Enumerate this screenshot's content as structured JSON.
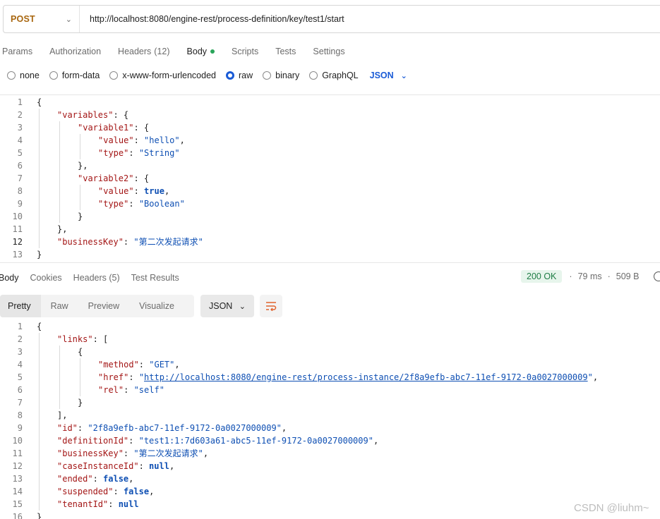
{
  "request": {
    "method": "POST",
    "url": "http://localhost:8080/engine-rest/process-definition/key/test1/start"
  },
  "request_tabs": {
    "params": "Params",
    "authorization": "Authorization",
    "headers": "Headers",
    "headers_count": "(12)",
    "body": "Body",
    "scripts": "Scripts",
    "tests": "Tests",
    "settings": "Settings"
  },
  "body_types": {
    "none": "none",
    "form_data": "form-data",
    "urlencoded": "x-www-form-urlencoded",
    "raw": "raw",
    "binary": "binary",
    "graphql": "GraphQL",
    "selected": "raw",
    "format": "JSON"
  },
  "request_body": {
    "lines": [
      {
        "n": "1",
        "t": "{"
      },
      {
        "n": "2",
        "k": "\"variables\"",
        "t2": ": {"
      },
      {
        "n": "3",
        "k": "\"variable1\"",
        "t2": ": {"
      },
      {
        "n": "4",
        "k": "\"value\"",
        "t2": ": ",
        "s": "\"hello\"",
        "t3": ","
      },
      {
        "n": "5",
        "k": "\"type\"",
        "t2": ": ",
        "s": "\"String\""
      },
      {
        "n": "6",
        "t": "},"
      },
      {
        "n": "7",
        "k": "\"variable2\"",
        "t2": ": {"
      },
      {
        "n": "8",
        "k": "\"value\"",
        "t2": ": ",
        "b": "true",
        "t3": ","
      },
      {
        "n": "9",
        "k": "\"type\"",
        "t2": ": ",
        "s": "\"Boolean\""
      },
      {
        "n": "10",
        "t": "}"
      },
      {
        "n": "11",
        "t": "},"
      },
      {
        "n": "12",
        "k": "\"businessKey\"",
        "t2": ": ",
        "s": "\"第二次发起请求\""
      },
      {
        "n": "13",
        "t": "}"
      }
    ]
  },
  "response_tabs": {
    "body": "Body",
    "cookies": "Cookies",
    "headers": "Headers (5)",
    "test_results": "Test Results"
  },
  "response_status": {
    "code": "200 OK",
    "time": "79 ms",
    "size": "509 B"
  },
  "view_tabs": {
    "pretty": "Pretty",
    "raw": "Raw",
    "preview": "Preview",
    "visualize": "Visualize",
    "format": "JSON"
  },
  "response_body": {
    "lines": [
      {
        "n": "1",
        "t": "{"
      },
      {
        "n": "2",
        "k": "\"links\"",
        "t2": ": ["
      },
      {
        "n": "3",
        "t": "{"
      },
      {
        "n": "4",
        "k": "\"method\"",
        "t2": ": ",
        "s": "\"GET\"",
        "t3": ","
      },
      {
        "n": "5",
        "k": "\"href\"",
        "t2": ": ",
        "s": "\"",
        "u": "http://localhost:8080/engine-rest/process-instance/2f8a9efb-abc7-11ef-9172-0a0027000009",
        "s2": "\"",
        "t3": ","
      },
      {
        "n": "6",
        "k": "\"rel\"",
        "t2": ": ",
        "s": "\"self\""
      },
      {
        "n": "7",
        "t": "}"
      },
      {
        "n": "8",
        "t": "],"
      },
      {
        "n": "9",
        "k": "\"id\"",
        "t2": ": ",
        "s": "\"2f8a9efb-abc7-11ef-9172-0a0027000009\"",
        "t3": ","
      },
      {
        "n": "10",
        "k": "\"definitionId\"",
        "t2": ": ",
        "s": "\"test1:1:7d603a61-abc5-11ef-9172-0a0027000009\"",
        "t3": ","
      },
      {
        "n": "11",
        "k": "\"businessKey\"",
        "t2": ": ",
        "s": "\"第二次发起请求\"",
        "t3": ","
      },
      {
        "n": "12",
        "k": "\"caseInstanceId\"",
        "t2": ": ",
        "b": "null",
        "t3": ","
      },
      {
        "n": "13",
        "k": "\"ended\"",
        "t2": ": ",
        "b": "false",
        "t3": ","
      },
      {
        "n": "14",
        "k": "\"suspended\"",
        "t2": ": ",
        "b": "false",
        "t3": ","
      },
      {
        "n": "15",
        "k": "\"tenantId\"",
        "t2": ": ",
        "b": "null"
      },
      {
        "n": "16",
        "t": "}"
      }
    ]
  },
  "watermark": "CSDN @liuhm~",
  "colors": {
    "method": "#a8660f",
    "accent": "#1a5bd6",
    "status_ok": "#1e7d45",
    "json_key": "#a31515",
    "json_string": "#0e4fb3"
  }
}
